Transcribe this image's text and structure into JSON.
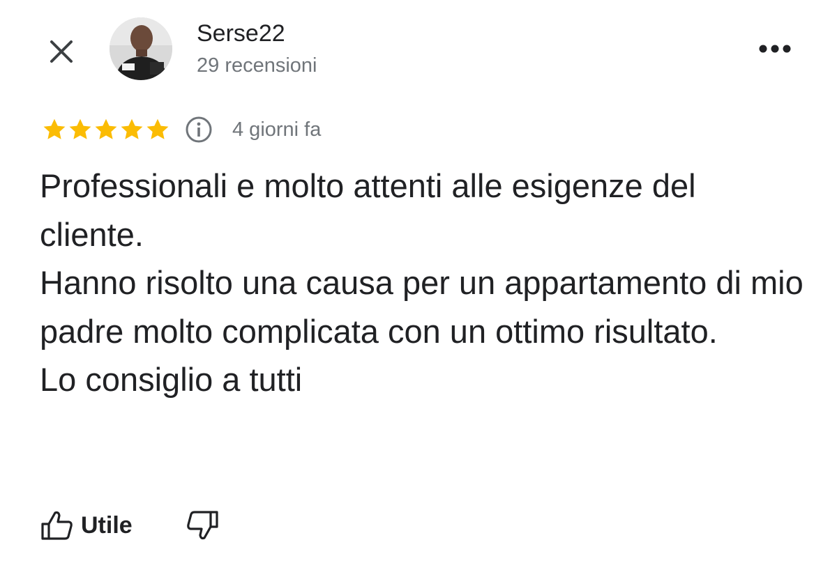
{
  "header": {
    "close_icon": "close-icon",
    "author_name": "Serse22",
    "author_review_count": "29 recensioni",
    "more_icon": "more-horizontal-icon"
  },
  "review": {
    "rating": 5,
    "rating_max": 5,
    "star_color": "#fbbc04",
    "info_icon": "info-icon",
    "time_ago": "4 giorni fa",
    "paragraphs": [
      "Professionali e molto attenti alle esigenze del cliente.",
      "Hanno risolto una causa per un appartamento di mio padre molto complicata con un ottimo risultato.",
      "Lo consiglio a tutti"
    ]
  },
  "actions": {
    "helpful_label": "Utile",
    "helpful_icon": "thumbs-up-icon",
    "dislike_icon": "thumbs-down-icon"
  }
}
